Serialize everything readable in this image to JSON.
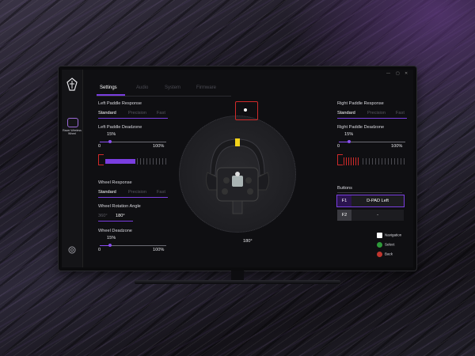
{
  "sidebar": {
    "device_label": "Racer Wireless Wheel"
  },
  "window": {
    "min": "—",
    "max": "▢",
    "close": "✕"
  },
  "tabs": [
    {
      "label": "Settings",
      "active": true
    },
    {
      "label": "Audio",
      "active": false
    },
    {
      "label": "System",
      "active": false
    },
    {
      "label": "Firmware",
      "active": false
    }
  ],
  "left": {
    "paddle_response": {
      "title": "Left Paddle Response",
      "options": [
        "Standard",
        "Precision",
        "Fast"
      ],
      "selected": "Standard"
    },
    "paddle_deadzone": {
      "title": "Left Paddle Deadzone",
      "value": "15%",
      "min": "0",
      "max": "100%",
      "fraction": 0.15
    },
    "wheel_response": {
      "title": "Wheel Response",
      "options": [
        "Standard",
        "Precision",
        "Fast"
      ],
      "selected": "Standard"
    },
    "rotation_angle": {
      "title": "Wheel Rotation Angle",
      "options": [
        "360°",
        "180°"
      ],
      "selected": "180°"
    },
    "wheel_deadzone": {
      "title": "Wheel Deadzone",
      "value": "15%",
      "min": "0",
      "max": "100%",
      "fraction": 0.15
    }
  },
  "center": {
    "degree": "180°"
  },
  "right": {
    "paddle_response": {
      "title": "Right Paddle Response",
      "options": [
        "Standard",
        "Precision",
        "Fast"
      ],
      "selected": "Standard"
    },
    "paddle_deadzone": {
      "title": "Right Paddle Deadzone",
      "value": "15%",
      "min": "0",
      "max": "100%",
      "fraction": 0.15
    },
    "buttons": {
      "title": "Buttons",
      "rows": [
        {
          "key": "F1",
          "value": "D-PAD Left",
          "active": true
        },
        {
          "key": "F2",
          "value": "-",
          "active": false
        }
      ]
    }
  },
  "legend": [
    {
      "label": "Navigation",
      "icon": "dpad-icon",
      "color": "#ffffff"
    },
    {
      "label": "Select",
      "icon": "a-button-icon",
      "color": "#2e9a3a"
    },
    {
      "label": "Back",
      "icon": "b-button-icon",
      "color": "#c0352e"
    }
  ],
  "colors": {
    "accent": "#7a3ee0",
    "alert": "#d02a2a",
    "wheel_mark": "#f2d21a"
  }
}
